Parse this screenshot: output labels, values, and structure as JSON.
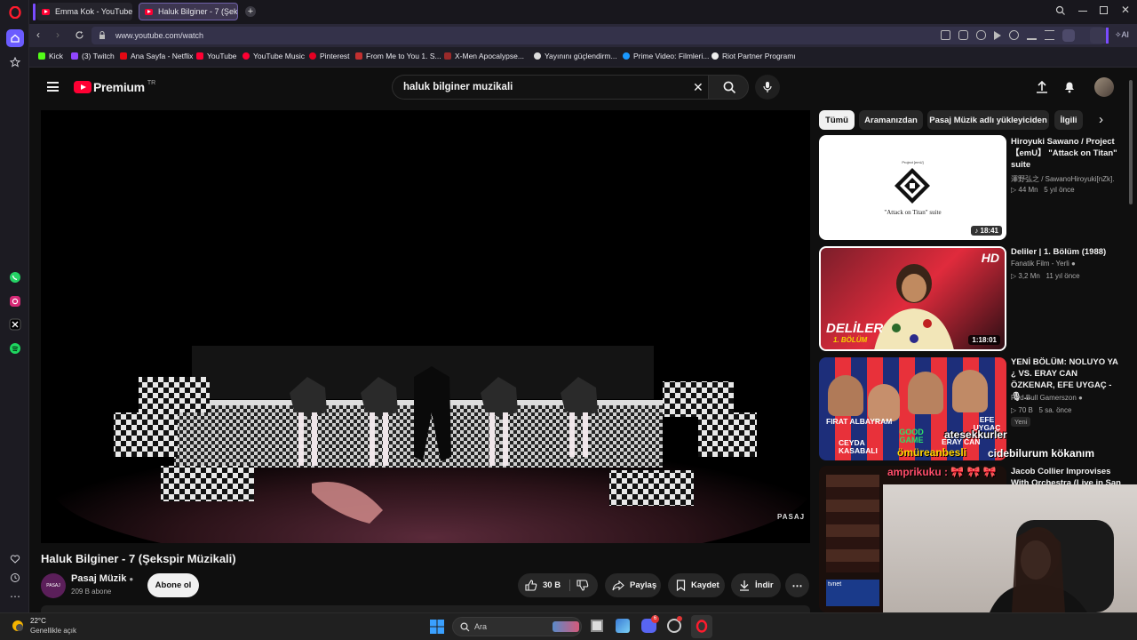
{
  "browser": {
    "tabs": [
      {
        "title": "Emma Kok - YouTube",
        "active": false
      },
      {
        "title": "Haluk Bilginer - 7 (Şekspir",
        "active": true
      }
    ],
    "url": "www.youtube.com/watch",
    "ai_label": "AI",
    "bookmarks": [
      "Kick",
      "(3) Twitch",
      "Ana Sayfa - Netflix",
      "YouTube",
      "YouTube Music",
      "Pinterest",
      "From Me to You 1. S...",
      "X-Men Apocalypse...",
      "Yayınını güçlendirm...",
      "Prime Video: Filmleri...",
      "Riot Partner Programı"
    ]
  },
  "youtube": {
    "logo_text": "Premium",
    "region": "TR",
    "search_query": "haluk bilginer muzikali",
    "video": {
      "watermark": "PASAJ",
      "title": "Haluk Bilginer - 7 (Şekspir Müzikali)",
      "channel": "Pasaj Müzik",
      "subscribers": "209 B abone",
      "subscribe_label": "Abone ol",
      "likes": "30 B",
      "share_label": "Paylaş",
      "save_label": "Kaydet",
      "download_label": "İndir",
      "avatar_text": "PASAJ"
    },
    "chips": [
      "Tümü",
      "Aramanızdan",
      "Pasaj Müzik adlı yükleyiciden",
      "İlgili"
    ],
    "recommendations": [
      {
        "title": "Hiroyuki Sawano / Project 【emU】 \"Attack on Titan\" suite",
        "channel": "澤野弘之 / SawanoHiroyuki[nZk].",
        "views": "44 Mn",
        "age": "5 yıl önce",
        "duration": "18:41",
        "thumb_caption": "\"Attack on Titan\" suite",
        "thumb_top": "Project [emU]"
      },
      {
        "title": "Deliler | 1. Bölüm (1988)",
        "channel": "Fanatik Film - Yerli",
        "views": "3,2 Mn",
        "age": "11 yıl önce",
        "duration": "1:18:01",
        "badge": "HD",
        "thumb_title": "DELİLER",
        "thumb_sub": "1. BÖLÜM"
      },
      {
        "title": "YENİ BÖLÜM: NOLUYO YA ¿ VS. ERAY CAN ÖZKENAR, EFE UYGAÇ - 🎙 ...",
        "channel": "Red Bull Gamerszon",
        "views": "70 B",
        "age": "5 sa. önce",
        "tag": "Yeni",
        "thumb_names": [
          "FIRAT ALBAYRAM",
          "CEYDA KASABALI",
          "GOOD GAME",
          "EFE UYGAÇ",
          "ERAY CAN"
        ]
      },
      {
        "title": "Jacob Collier Improvises With Orchestra (Live in San",
        "channel": "",
        "views": "",
        "age": ""
      }
    ],
    "overlay": {
      "chat_line1": "atesekkurler",
      "chat_line2": "ömüreanbesli",
      "chat_line3": "cidebilurum kökanım",
      "chat_user": "amprikuku :",
      "chat_emotes": "🎀 🎀 🎀",
      "thumb_small": "tvnet"
    }
  },
  "taskbar": {
    "temperature": "22°C",
    "weather": "Genellikle açık",
    "search_placeholder": "Ara",
    "discord_badge": "6"
  }
}
